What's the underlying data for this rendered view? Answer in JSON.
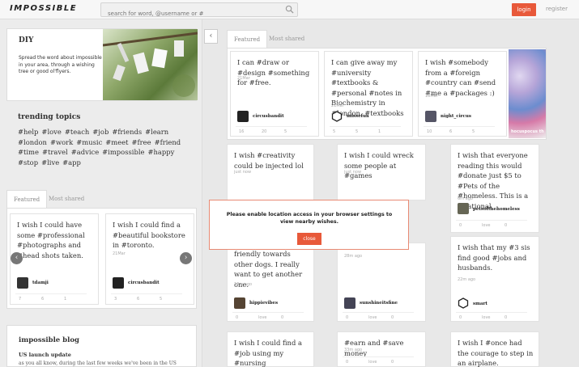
{
  "header": {
    "logo": "IMPOSSIBLE",
    "search_placeholder": "search for word, @username or #",
    "login": "login",
    "register": "register"
  },
  "diy": {
    "title": "DIY",
    "text": "Spread the word about impossible in your area, through a wishing tree or good ol'flyers."
  },
  "trending": {
    "title": "trending topics",
    "tags": [
      "#help",
      "#love",
      "#teach",
      "#job",
      "#friends",
      "#learn",
      "#london",
      "#work",
      "#music",
      "#meet",
      "#free",
      "#friend",
      "#time",
      "#travel",
      "#advice",
      "#impossible",
      "#happy",
      "#stop",
      "#live",
      "#app"
    ]
  },
  "left_tabs": {
    "featured": "Featured",
    "most_shared": "Most shared"
  },
  "left_cards": [
    {
      "text": "I wish I could have some #professional #photographs and #head shots taken.",
      "time": "",
      "user": "tdamji",
      "a": "7",
      "b": "6",
      "c": "1"
    },
    {
      "text": "I wish I could find a #beautiful bookstore in #toronto.",
      "time": "21Mar",
      "user": "circusbandit",
      "a": "3",
      "b": "6",
      "c": "5"
    }
  ],
  "blog": {
    "title": "impossible blog",
    "post_title": "US launch update",
    "excerpt": "as you all know, during the last few weeks we've been in the US"
  },
  "right_tabs": {
    "featured": "Featured",
    "most_shared": "Most shared"
  },
  "featured_cards": [
    {
      "text": "I can #draw or #design #something for #free.",
      "time": "21Mar",
      "user": "circusbandit",
      "a": "16",
      "b": "20",
      "c": "5"
    },
    {
      "text": "I can give away my #university #textbooks & #personal #notes in Biochemistry in #london. #textbooks",
      "time": "21Mar",
      "user": "missefua",
      "a": "5",
      "b": "5",
      "c": "1"
    },
    {
      "text": "I wish #somebody from a #foreign #country can #send #me a #packages :)",
      "time": "18Mar",
      "user": "night_circus",
      "a": "10",
      "b": "6",
      "c": "5"
    }
  ],
  "featured_photo_caption": "hocuspocus th",
  "grid_cards": [
    {
      "text": "I wish #creativity could be injected lol",
      "time": "just now"
    },
    {
      "text": "I wish I could wreck some people at #games",
      "time": "just now"
    },
    {
      "text": "I wish that everyone reading this would #donate just $5 to #Pets of the #homeless. This is a #national",
      "time": "6m ago",
      "user": "petsofthehomeless",
      "a": "0",
      "b": "love",
      "c": "0"
    },
    {
      "text": "friendly towards other dogs. I really want to get another one.",
      "time": "16m ago",
      "user": "hippievibes",
      "a": "0",
      "b": "love",
      "c": "0"
    },
    {
      "text": "",
      "time": "28m ago",
      "user": "sunshineitsfine",
      "a": "0",
      "b": "love",
      "c": "0"
    },
    {
      "text": "I wish that my #3 sis find good #jobs and husbands.",
      "time": "22m ago",
      "user": "smart",
      "a": "0",
      "b": "love",
      "c": "0"
    },
    {
      "text": "I wish I could find a #job using my #nursing background that isn't",
      "time": ""
    },
    {
      "text": "#earn and #save money",
      "time": "33m ago",
      "a": "0",
      "b": "love",
      "c": "0"
    },
    {
      "text": "I wish I #once had the courage to step in an airplane.",
      "time": ""
    }
  ],
  "modal": {
    "message": "Please enable location access in your browser settings to view nearby wishes.",
    "close": "close"
  }
}
